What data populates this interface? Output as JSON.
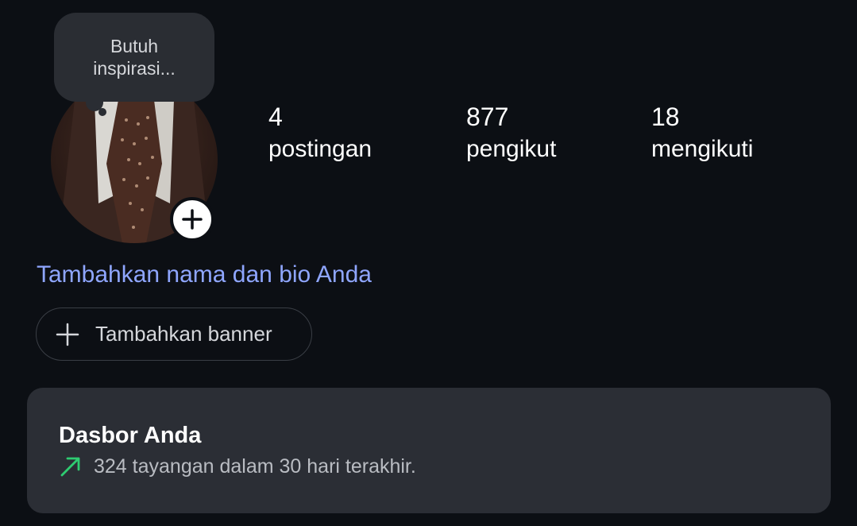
{
  "note": {
    "text": "Butuh inspirasi..."
  },
  "avatar": {
    "alt": "profile picture"
  },
  "stats": {
    "posts": {
      "count": "4",
      "label": "postingan"
    },
    "followers": {
      "count": "877",
      "label": "pengikut"
    },
    "following": {
      "count": "18",
      "label": "mengikuti"
    }
  },
  "profile": {
    "add_bio_label": "Tambahkan nama dan bio Anda",
    "add_banner_label": "Tambahkan banner"
  },
  "dashboard": {
    "title": "Dasbor Anda",
    "views_text": "324 tayangan dalam 30 hari terakhir.",
    "trend_icon": "trending-up-arrow-icon",
    "trend_color": "#2ecc71"
  },
  "colors": {
    "background": "#0c0f14",
    "link": "#8fa6ff",
    "card": "#2b2e35"
  }
}
